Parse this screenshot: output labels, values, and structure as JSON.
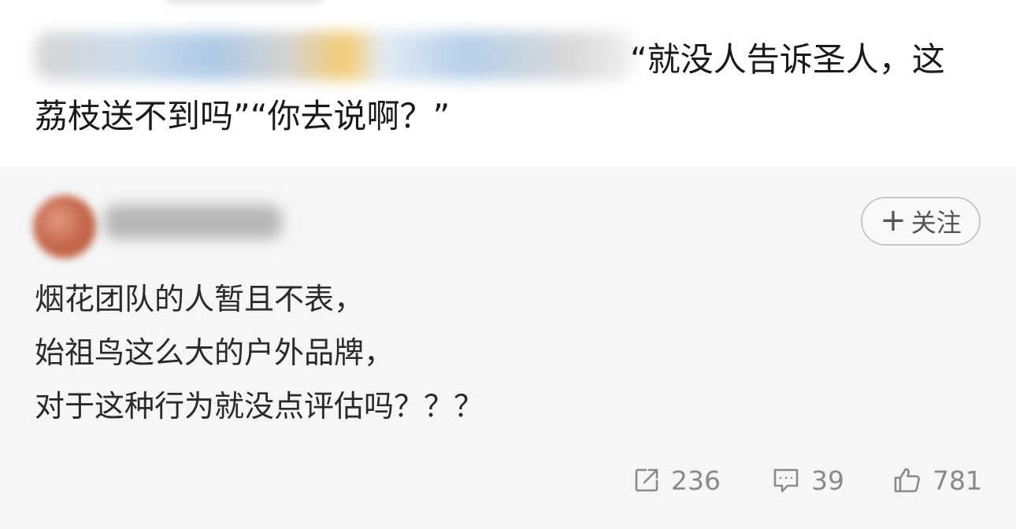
{
  "post": {
    "line1": "“就没人告诉圣人，这",
    "line2": "荔枝送不到吗”“你去说啊？”"
  },
  "comment": {
    "follow_plus": "+",
    "follow_label": "关注",
    "lines": [
      "烟花团队的人暂且不表，",
      "始祖鸟这么大的户外品牌，",
      "对于这种行为就没点评估吗？？？"
    ],
    "actions": {
      "share": {
        "icon": "share-icon",
        "count": "236"
      },
      "reply": {
        "icon": "comment-icon",
        "count": "39"
      },
      "like": {
        "icon": "thumbs-up-icon",
        "count": "781"
      }
    }
  },
  "colors": {
    "comment_background": "#f6f6f6",
    "text_primary": "#1a1a1a",
    "action_gray": "#8a8a8a",
    "follow_border": "#c8c8c8"
  }
}
